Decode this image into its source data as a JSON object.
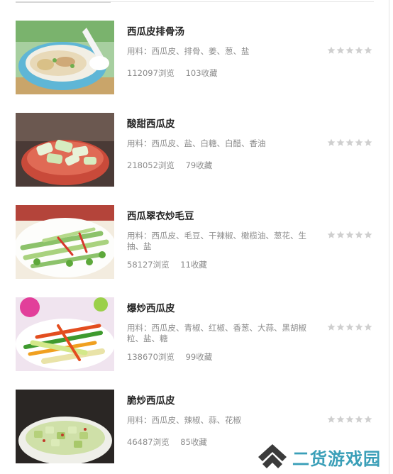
{
  "recipes": [
    {
      "title": "西瓜皮排骨汤",
      "ingredients_label": "用料：",
      "ingredients": "西瓜皮、排骨、姜、葱、盐",
      "views": "112097浏览",
      "favorites": "103收藏",
      "rating_stars": 0
    },
    {
      "title": "酸甜西瓜皮",
      "ingredients_label": "用料：",
      "ingredients": "西瓜皮、盐、白糖、白醋、香油",
      "views": "218052浏览",
      "favorites": "79收藏",
      "rating_stars": 0
    },
    {
      "title": "西瓜翠衣炒毛豆",
      "ingredients_label": "用料：",
      "ingredients": "西瓜皮、毛豆、干辣椒、橄榄油、葱花、生抽、盐",
      "views": "58127浏览",
      "favorites": "11收藏",
      "rating_stars": 0
    },
    {
      "title": "爆炒西瓜皮",
      "ingredients_label": "用料：",
      "ingredients": "西瓜皮、青椒、红椒、香葱、大蒜、黑胡椒粒、盐、糖",
      "views": "138670浏览",
      "favorites": "99收藏",
      "rating_stars": 0
    },
    {
      "title": "脆炒西瓜皮",
      "ingredients_label": "用料：",
      "ingredients": "西瓜皮、辣椒、蒜、花椒",
      "views": "46487浏览",
      "favorites": "85收藏",
      "rating_stars": 0
    }
  ],
  "watermark": {
    "text": "二货游戏园"
  },
  "colors": {
    "text_title": "#222222",
    "text_meta": "#8c8c8c",
    "star_empty": "#cfcfcf",
    "watermark_text": "#3a9fb8",
    "watermark_logo": "#3b3b3b"
  }
}
